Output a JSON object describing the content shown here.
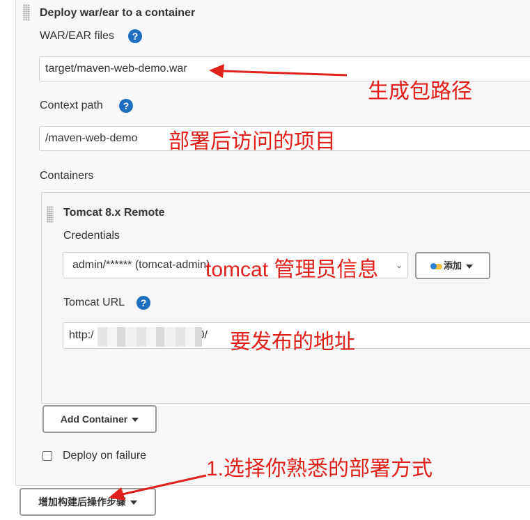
{
  "section": {
    "title": "Deploy war/ear to a container",
    "war_label": "WAR/EAR files",
    "war_value": "target/maven-web-demo.war",
    "context_label": "Context path",
    "context_value": "/maven-web-demo",
    "containers_label": "Containers"
  },
  "container": {
    "title": "Tomcat 8.x Remote",
    "credentials_label": "Credentials",
    "credentials_value": "admin/****** (tomcat-admin)",
    "add_button_label": "添加",
    "url_label": "Tomcat URL",
    "url_prefix": "http:/",
    "url_suffix": "0/"
  },
  "buttons": {
    "add_container": "Add Container",
    "add_post_build": "增加构建后操作步骤"
  },
  "deploy_on_failure": {
    "label": "Deploy on failure",
    "checked": false
  },
  "help_glyph": "?",
  "annotations": {
    "war": "生成包路径",
    "context": "部署后访问的项目",
    "credentials": "tomcat 管理员信息",
    "url": "要发布的地址",
    "step": "1.选择你熟悉的部署方式",
    "color": "#e0201a"
  }
}
